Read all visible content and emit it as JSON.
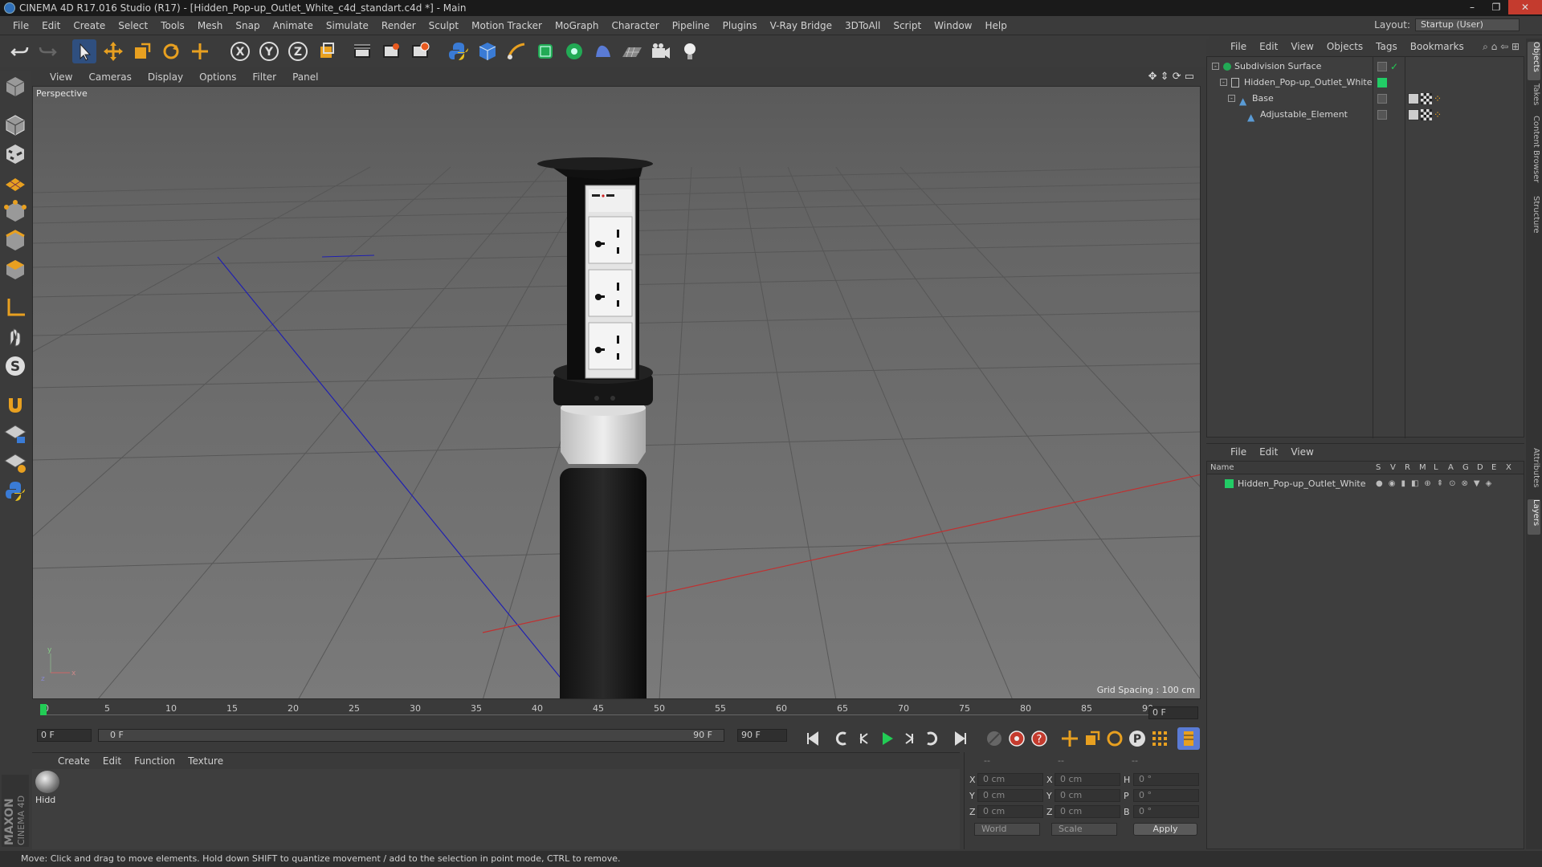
{
  "window": {
    "title": "CINEMA 4D R17.016 Studio (R17) - [Hidden_Pop-up_Outlet_White_c4d_standart.c4d *] - Main",
    "controls": [
      "–",
      "❐",
      "✕"
    ]
  },
  "menubar": [
    "File",
    "Edit",
    "Create",
    "Select",
    "Tools",
    "Mesh",
    "Snap",
    "Animate",
    "Simulate",
    "Render",
    "Sculpt",
    "Motion Tracker",
    "MoGraph",
    "Character",
    "Pipeline",
    "Plugins",
    "V-Ray Bridge",
    "3DToAll",
    "Script",
    "Window",
    "Help"
  ],
  "layout": {
    "label": "Layout:",
    "value": "Startup (User)"
  },
  "viewport": {
    "menu": [
      "View",
      "Cameras",
      "Display",
      "Options",
      "Filter",
      "Panel"
    ],
    "label": "Perspective",
    "grid_spacing": "Grid Spacing : 100 cm"
  },
  "timeline": {
    "ticks": [
      "0",
      "5",
      "10",
      "15",
      "20",
      "25",
      "30",
      "35",
      "40",
      "45",
      "50",
      "55",
      "60",
      "65",
      "70",
      "75",
      "80",
      "85",
      "90"
    ],
    "current_frame": "0 F"
  },
  "transport": {
    "start": "0 F",
    "range_start": "0 F",
    "range_end": "90 F",
    "end": "90 F"
  },
  "material_manager": {
    "menu": [
      "Create",
      "Edit",
      "Function",
      "Texture"
    ],
    "materials": [
      {
        "label": "Hidd"
      }
    ]
  },
  "coordinates": {
    "headers": [
      "--",
      "--",
      "--"
    ],
    "rows": [
      {
        "a": "X",
        "av": "0 cm",
        "b": "X",
        "bv": "0 cm",
        "c": "H",
        "cv": "0 °"
      },
      {
        "a": "Y",
        "av": "0 cm",
        "b": "Y",
        "bv": "0 cm",
        "c": "P",
        "cv": "0 °"
      },
      {
        "a": "Z",
        "av": "0 cm",
        "b": "Z",
        "bv": "0 cm",
        "c": "B",
        "cv": "0 °"
      }
    ],
    "mode1": "World",
    "mode2": "Scale",
    "apply": "Apply"
  },
  "object_manager": {
    "menu": [
      "File",
      "Edit",
      "View",
      "Objects",
      "Tags",
      "Bookmarks"
    ],
    "objects": [
      {
        "name": "Subdivision Surface",
        "indent": 0
      },
      {
        "name": "Hidden_Pop-up_Outlet_White",
        "indent": 1
      },
      {
        "name": "Base",
        "indent": 2
      },
      {
        "name": "Adjustable_Element",
        "indent": 3
      }
    ]
  },
  "layer_manager": {
    "menu": [
      "File",
      "Edit",
      "View"
    ],
    "columns": [
      "Name",
      "S",
      "V",
      "R",
      "M",
      "L",
      "A",
      "G",
      "D",
      "E",
      "X"
    ],
    "layers": [
      {
        "name": "Hidden_Pop-up_Outlet_White",
        "color": "#22cc66"
      }
    ]
  },
  "side_tabs": [
    "Objects",
    "Takes",
    "Content Browser",
    "Structure",
    "Attributes",
    "Layers"
  ],
  "status": "Move: Click and drag to move elements. Hold down SHIFT to quantize movement / add to the selection in point mode, CTRL to remove.",
  "logo": {
    "line1": "MAXON",
    "line2": "CINEMA 4D"
  },
  "colors": {
    "accent_blue": "#3a7bd5",
    "active_orange": "#e8a020",
    "layer_green": "#22cc66",
    "close_red": "#c43b2e"
  }
}
